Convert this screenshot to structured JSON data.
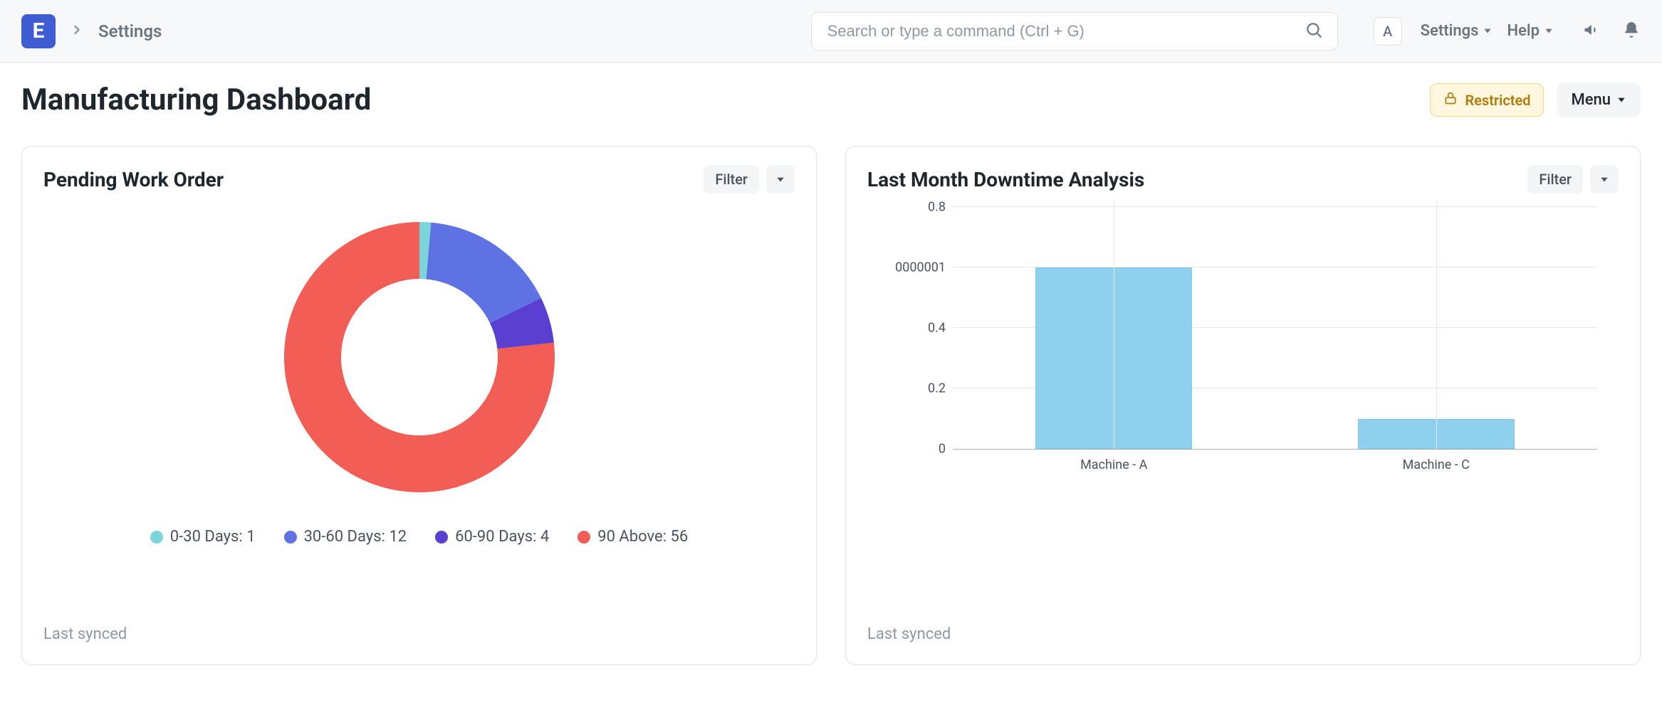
{
  "nav": {
    "logo_letter": "E",
    "breadcrumb": "Settings",
    "search_placeholder": "Search or type a command (Ctrl + G)",
    "avatar_letter": "A",
    "settings_label": "Settings",
    "help_label": "Help"
  },
  "page": {
    "title": "Manufacturing Dashboard",
    "restricted_label": "Restricted",
    "menu_label": "Menu"
  },
  "cards": {
    "pending": {
      "title": "Pending Work Order",
      "filter_label": "Filter",
      "last_synced": "Last synced",
      "legend": [
        {
          "label": "0-30 Days: 1"
        },
        {
          "label": "30-60 Days: 12"
        },
        {
          "label": "60-90 Days: 4"
        },
        {
          "label": "90 Above: 56"
        }
      ]
    },
    "downtime": {
      "title": "Last Month Downtime Analysis",
      "filter_label": "Filter",
      "last_synced": "Last synced",
      "y_ticks": [
        "0",
        "0.2",
        "0.4",
        "0000001",
        "0.8"
      ],
      "x_labels": [
        "Machine - A",
        "Machine - C"
      ]
    }
  },
  "colors": {
    "donut": [
      "#7cd6d9",
      "#5e72e4",
      "#5a3fd1",
      "#f25d55"
    ],
    "bar": "#8fd0ef"
  },
  "chart_data": [
    {
      "type": "pie",
      "title": "Pending Work Order",
      "categories": [
        "0-30 Days",
        "30-60 Days",
        "60-90 Days",
        "90 Above"
      ],
      "values": [
        1,
        12,
        4,
        56
      ],
      "colors": [
        "#7cd6d9",
        "#5e72e4",
        "#5a3fd1",
        "#f25d55"
      ],
      "donut": true
    },
    {
      "type": "bar",
      "title": "Last Month Downtime Analysis",
      "categories": [
        "Machine - A",
        "Machine - C"
      ],
      "values": [
        0.6,
        0.1
      ],
      "ylim": [
        0,
        0.8
      ],
      "y_ticks": [
        0,
        0.2,
        0.4,
        0.6,
        0.8
      ],
      "color": "#8fd0ef"
    }
  ]
}
